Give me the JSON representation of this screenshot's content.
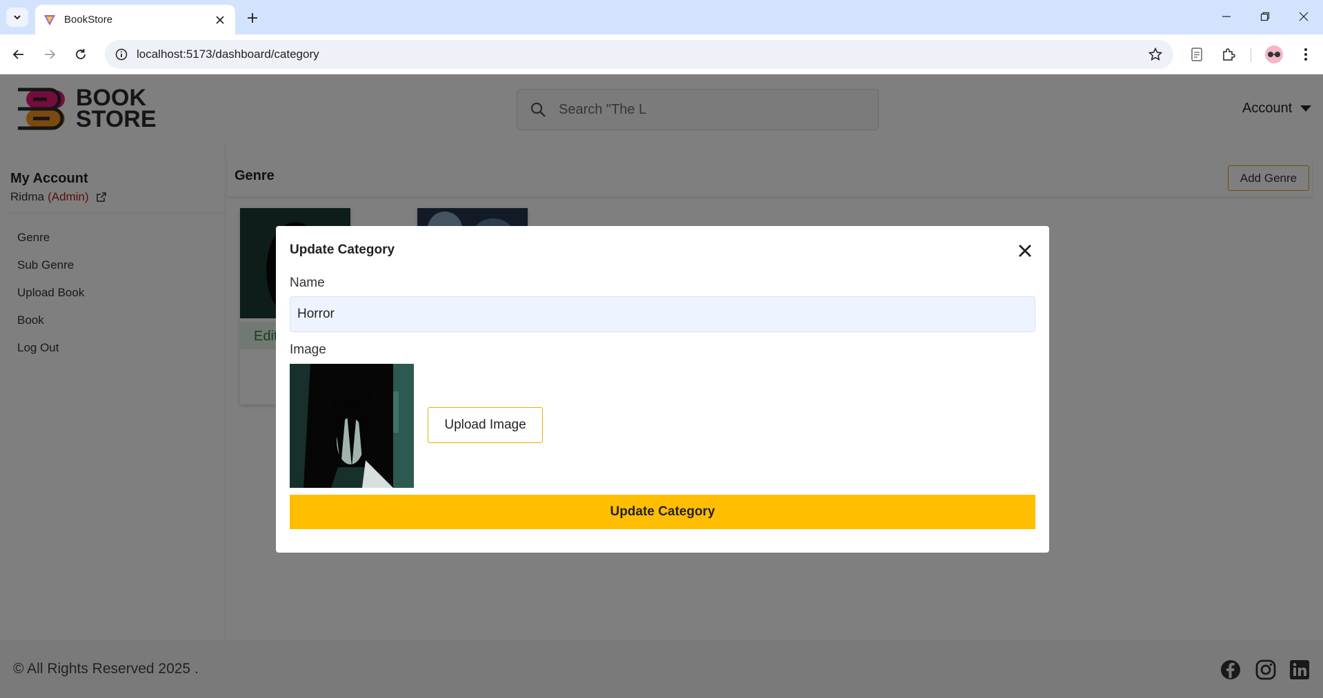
{
  "browser": {
    "tab_title": "BookStore",
    "url": "localhost:5173/dashboard/category"
  },
  "header": {
    "logo_line1": "BOOK",
    "logo_line2": "STORE",
    "search_placeholder": "Search \"The L",
    "account_label": "Account"
  },
  "sidebar": {
    "title": "My Account",
    "user_name": "Ridma",
    "user_role": "(Admin)",
    "items": [
      {
        "label": "Genre"
      },
      {
        "label": "Sub Genre"
      },
      {
        "label": "Upload Book"
      },
      {
        "label": "Book"
      },
      {
        "label": "Log Out"
      }
    ]
  },
  "content": {
    "title": "Genre",
    "add_button": "Add Genre",
    "edit_label": "Edit"
  },
  "modal": {
    "title": "Update Category",
    "name_label": "Name",
    "name_value": "Horror",
    "image_label": "Image",
    "upload_button": "Upload Image",
    "submit_button": "Update Category"
  },
  "footer": {
    "copyright": "© All Rights Reserved 2025 ."
  },
  "colors": {
    "accent": "#ffbf00",
    "admin_role": "#b71c1c",
    "logo_pink": "#e8197d",
    "logo_orange": "#f7941d"
  }
}
